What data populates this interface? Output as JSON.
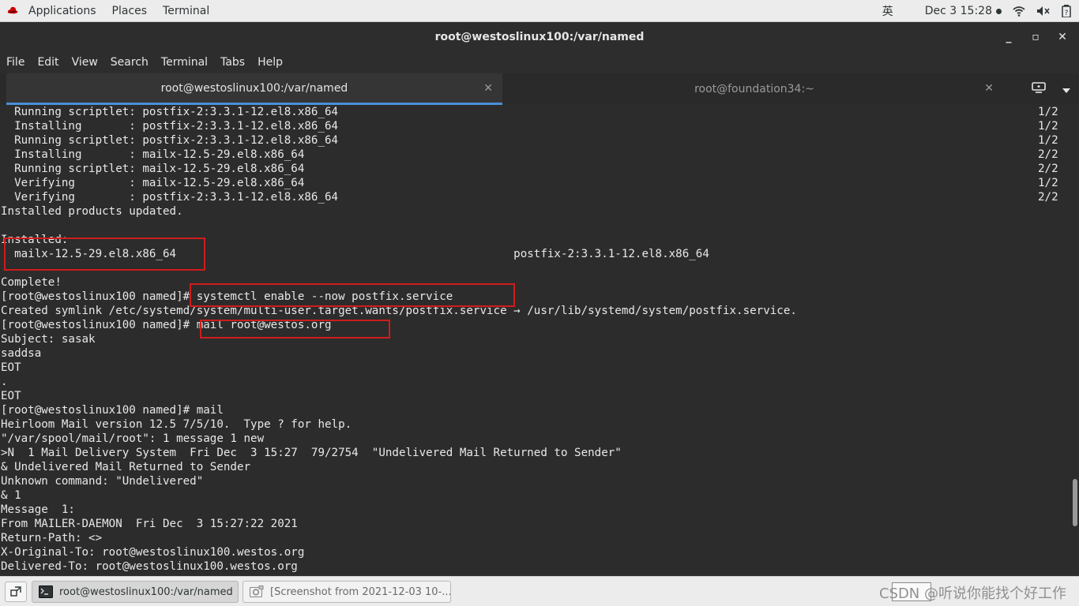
{
  "top_panel": {
    "applications": "Applications",
    "places": "Places",
    "terminal": "Terminal",
    "ime": "英",
    "clock": "Dec 3  15:28"
  },
  "window": {
    "title": "root@westoslinux100:/var/named",
    "minimize": "_",
    "maximize": "▫",
    "close": "✕"
  },
  "menubar": [
    "File",
    "Edit",
    "View",
    "Search",
    "Terminal",
    "Tabs",
    "Help"
  ],
  "tabs": [
    {
      "label": "root@westoslinux100:/var/named",
      "close": "✕"
    },
    {
      "label": "root@foundation34:~",
      "close": "✕"
    }
  ],
  "terminal": {
    "lines": [
      "  Running scriptlet: postfix-2:3.3.1-12.el8.x86_64",
      "  Installing       : postfix-2:3.3.1-12.el8.x86_64",
      "  Running scriptlet: postfix-2:3.3.1-12.el8.x86_64",
      "  Installing       : mailx-12.5-29.el8.x86_64",
      "  Running scriptlet: mailx-12.5-29.el8.x86_64",
      "  Verifying        : mailx-12.5-29.el8.x86_64",
      "  Verifying        : postfix-2:3.3.1-12.el8.x86_64",
      "Installed products updated.",
      "",
      "Installed:",
      "  mailx-12.5-29.el8.x86_64                                                  postfix-2:3.3.1-12.el8.x86_64",
      "",
      "Complete!",
      "[root@westoslinux100 named]# systemctl enable --now postfix.service",
      "Created symlink /etc/systemd/system/multi-user.target.wants/postfix.service → /usr/lib/systemd/system/postfix.service.",
      "[root@westoslinux100 named]# mail root@westos.org",
      "Subject: sasak",
      "saddsa",
      "EOT",
      ".",
      "EOT",
      "[root@westoslinux100 named]# mail",
      "Heirloom Mail version 12.5 7/5/10.  Type ? for help.",
      "\"/var/spool/mail/root\": 1 message 1 new",
      ">N  1 Mail Delivery System  Fri Dec  3 15:27  79/2754  \"Undelivered Mail Returned to Sender\"",
      "& Undelivered Mail Returned to Sender",
      "Unknown command: \"Undelivered\"",
      "& 1",
      "Message  1:",
      "From MAILER-DAEMON  Fri Dec  3 15:27:22 2021",
      "Return-Path: <>",
      "X-Original-To: root@westoslinux100.westos.org",
      "Delivered-To: root@westoslinux100.westos.org"
    ],
    "progress": [
      "1/2",
      "1/2",
      "1/2",
      "2/2",
      "2/2",
      "1/2",
      "2/2"
    ]
  },
  "taskbar": {
    "items": [
      {
        "label": "root@westoslinux100:/var/named"
      },
      {
        "label": "[Screenshot from 2021-12-03 10-..."
      }
    ],
    "watermark": "CSDN @听说你能找个好工作"
  },
  "colors": {
    "terminal_bg": "#2c2c2c",
    "terminal_fg": "#e8e8e8",
    "annotation": "#d01c1c",
    "tab_accent": "#4a90d9"
  }
}
